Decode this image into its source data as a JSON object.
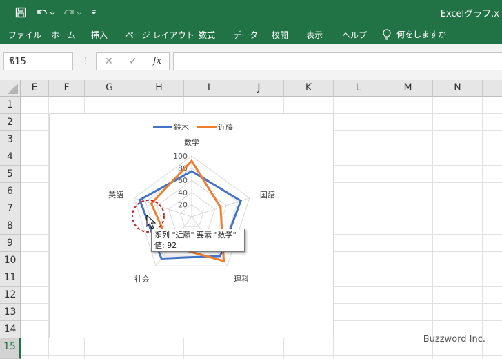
{
  "window": {
    "title": "Excelグラフ.x"
  },
  "quick_access": {
    "save_icon": "save-icon",
    "undo_icon": "undo-icon",
    "redo_icon": "redo-icon",
    "customize_icon": "customize-icon"
  },
  "ribbon": {
    "tabs": [
      "ファイル",
      "ホーム",
      "挿入",
      "ページ レイアウト",
      "数式",
      "データ",
      "校閲",
      "表示",
      "ヘルプ"
    ],
    "tell_me": "何をしますか"
  },
  "formula_bar": {
    "name_box": "S15",
    "cancel": "✕",
    "enter": "✓",
    "fx": "fx",
    "value": ""
  },
  "sheet": {
    "columns": [
      "E",
      "F",
      "G",
      "H",
      "I",
      "J",
      "K",
      "L",
      "M",
      "N"
    ],
    "rows": [
      "1",
      "2",
      "3",
      "4",
      "5",
      "6",
      "7",
      "8",
      "9",
      "10",
      "11",
      "12",
      "13",
      "14",
      "15"
    ],
    "selected_row": "15"
  },
  "chart_data": {
    "type": "radar",
    "categories": [
      "数学",
      "国語",
      "理科",
      "社会",
      "英語"
    ],
    "series": [
      {
        "name": "鈴木",
        "color": "#4472C4",
        "values": [
          75,
          85,
          80,
          85,
          90
        ]
      },
      {
        "name": "近藤",
        "color": "#ED7D31",
        "values": [
          92,
          50,
          90,
          60,
          70
        ]
      }
    ],
    "axis_labels": [
      "20",
      "40",
      "60",
      "80",
      "100"
    ],
    "rmax": 100,
    "legend_position": "top"
  },
  "tooltip": {
    "line1": "系列 \"近藤\" 要素 \"数学\"",
    "line2": "値: 92"
  },
  "watermark": "Buzzword Inc."
}
